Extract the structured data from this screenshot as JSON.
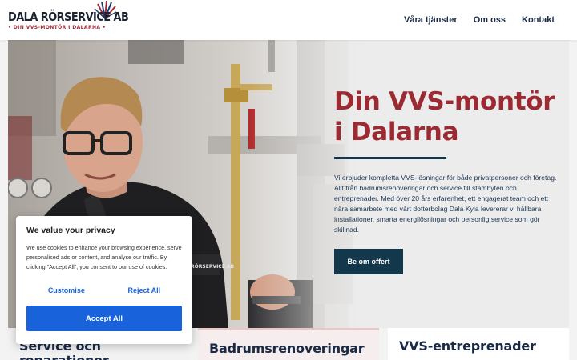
{
  "header": {
    "logo_name": "DALA RÖRSERVICE AB",
    "logo_tagline": "• DIN VVS-MONTÖR I DALARNA •",
    "nav": [
      "Våra tjänster",
      "Om oss",
      "Kontakt"
    ]
  },
  "hero": {
    "title": "Din VVS-montör i Dalarna",
    "text": "Vi erbjuder kompletta VVS-lösningar för både privatpersoner och företag. Allt från badrumsrenoveringar och service till stambyten och entreprenader. Med över 20 års erfarenhet, ett engagerat team och ett nära samarbete med vårt dotterbolag Dala Kyla levererar vi hållbara installationer, smarta energilösningar och personlig service som gör skillnad.",
    "cta": "Be om offert",
    "badge_text": "DALA RÖRSERVICE AB"
  },
  "services": [
    "Service och reparationer",
    "Badrumsrenoveringar",
    "VVS-entreprenader"
  ],
  "cookie": {
    "title": "We value your privacy",
    "text": "We use cookies to enhance your browsing experience, serve personalised ads or content, and analyse our traffic. By clicking \"Accept All\", you consent to our use of cookies.",
    "customise": "Customise",
    "reject": "Reject All",
    "accept": "Accept All"
  },
  "colors": {
    "brand_red": "#9c2a32",
    "brand_navy": "#13384b",
    "cookie_blue": "#1863dc"
  }
}
